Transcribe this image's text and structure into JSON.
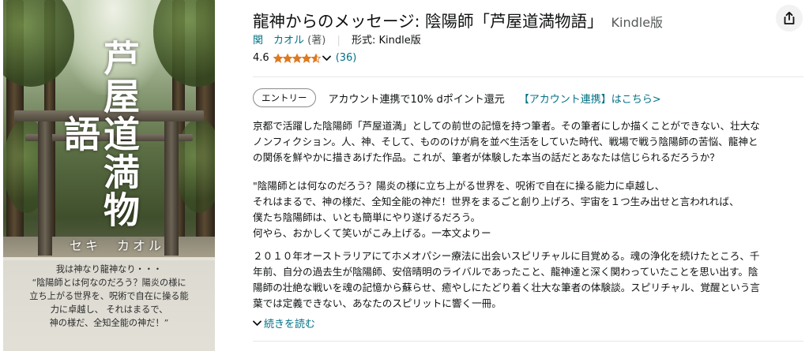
{
  "cover": {
    "title_vertical": "芦屋道満物語",
    "author": "セキ　カオル",
    "blurb_lines": [
      "我は神なり龍神なり・・・",
      "“陰陽師とは何なのだろう？陽炎の様に",
      "立ち上がる世界を、呪術で自在に操る能",
      "力に卓越し、 それはまるで、",
      "神の様だ、全知全能の神だ！”"
    ]
  },
  "product": {
    "title": "龍神からのメッセージ: 陰陽師「芦屋道満物語」",
    "format_tag": "Kindle版",
    "author_name": "関　カオル",
    "author_role": "(著)",
    "format_label": "形式: Kindle版",
    "rating_value": "4.6",
    "rating_fraction": 0.92,
    "rating_count": "(36)",
    "share_icon": "share-icon"
  },
  "promo": {
    "pill_label": "エントリー",
    "text": "アカウント連携で10% dポイント還元",
    "link": "【アカウント連携】はこちら>"
  },
  "description": {
    "para1": [
      "京都で活躍した陰陽師「芦屋道満」としての前世の記憶を持つ筆者。その筆者にしか描くことができない、壮大な",
      "ノンフィクション。人、神、そして、もののけが肩を並べ生活をしていた時代、戦場で戦う陰陽師の苦悩、龍神と",
      "の関係を鮮やかに描きあげた作品。これが、筆者が体験した本当の話だとあなたは信じられるだろうか？"
    ],
    "para2": [
      "\"陰陽師とは何なのだろう？陽炎の様に立ち上がる世界を、呪術で自在に操る能力に卓越し、",
      "それはまるで、神の様だ、全知全能の神だ！世界をまるごと創り上げろ、宇宙を１つ生み出せと言われれば、",
      "僕たち陰陽師は、いとも簡単にやり遂げるだろう。",
      "何やら、おかしくて笑いがこみ上げる。一本文よりー"
    ],
    "para3": [
      "２０１０年オーストラリアにてホメオパシー療法に出会いスピリチャルに目覚める。魂の浄化を続けたところ、千",
      "年前、自分の過去生が陰陽師、安倍晴明のライバルであったこと、龍神達と深く関わっていたことを思い出す。陰",
      "陽師の壮絶な戦いを魂の記憶から蘇らせ、癒やしにたどり着く壮大な筆者の体験談。スピリチャル、覚醒という言",
      "葉では定義できない、あなたのスピリットに響く一冊。"
    ],
    "read_more": "続きを読む"
  },
  "colors": {
    "link": "#007185",
    "star": "#de7921",
    "text": "#0f1111",
    "muted": "#565959"
  }
}
